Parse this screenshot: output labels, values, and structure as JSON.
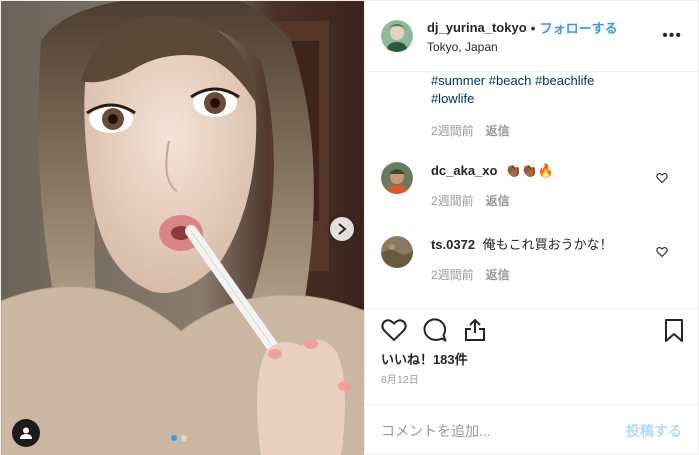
{
  "post": {
    "username": "dj_yurina_tokyo",
    "separator": "•",
    "follow_label": "フォローする",
    "location": "Tokyo, Japan",
    "more_icon": "more-options-icon",
    "more_text": "•••"
  },
  "caption": {
    "tags_line1": [
      "#summer",
      "#beach",
      "#beachlife"
    ],
    "tags_line2": [
      "#lowlife"
    ],
    "time": "2週間前",
    "reply": "返信"
  },
  "comments": [
    {
      "user": "dc_aka_xo",
      "text": "👏🏾👏🏾🔥",
      "time": "2週間前",
      "reply": "返信"
    },
    {
      "user": "ts.0372",
      "text": "俺もこれ買おうかな！",
      "time": "2週間前",
      "reply": "返信"
    }
  ],
  "actions": {
    "icons": [
      "heart-icon",
      "comment-icon",
      "share-icon",
      "bookmark-icon"
    ]
  },
  "likes_text": "いいね！183件",
  "date_text": "8月12日",
  "add_comment": {
    "placeholder": "コメントを追加...",
    "post_label": "投稿する"
  },
  "carousel": {
    "current": 1,
    "total": 2
  },
  "colors": {
    "link": "#003569",
    "accent": "#3897f0",
    "muted": "#999999",
    "post_disabled": "#b3dbff"
  }
}
